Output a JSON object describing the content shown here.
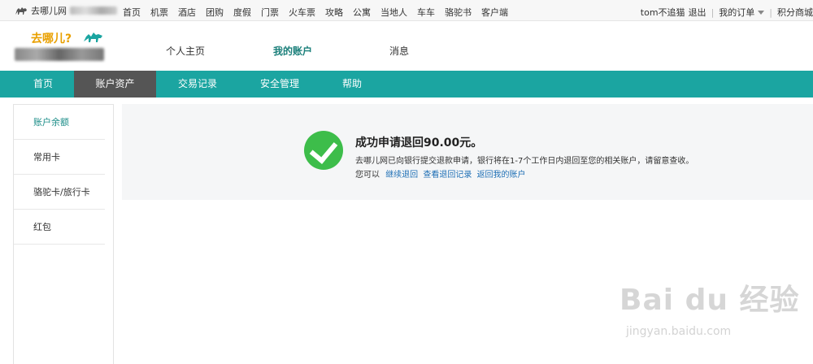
{
  "topbar": {
    "brand": "去哪儿网",
    "nav": [
      "首页",
      "机票",
      "酒店",
      "团购",
      "度假",
      "门票",
      "火车票",
      "攻略",
      "公寓",
      "当地人",
      "车车",
      "骆驼书",
      "客户端"
    ],
    "user": "tom不追猫",
    "logout": "退出",
    "my_orders": "我的订单",
    "points_mall": "积分商城"
  },
  "header": {
    "logo_text": "去哪儿?",
    "nav": [
      {
        "label": "个人主页",
        "active": false
      },
      {
        "label": "我的账户",
        "active": true
      },
      {
        "label": "消息",
        "active": false
      }
    ]
  },
  "mainnav": {
    "items": [
      {
        "label": "首页",
        "active": false
      },
      {
        "label": "账户资产",
        "active": true
      },
      {
        "label": "交易记录",
        "active": false
      },
      {
        "label": "安全管理",
        "active": false
      },
      {
        "label": "帮助",
        "active": false
      }
    ]
  },
  "sidebar": {
    "items": [
      {
        "label": "账户余额",
        "active": true
      },
      {
        "label": "常用卡",
        "active": false
      },
      {
        "label": "骆驼卡/旅行卡",
        "active": false
      },
      {
        "label": "红包",
        "active": false
      }
    ]
  },
  "message": {
    "title": "成功申请退回90.00元。",
    "desc": "去哪儿网已向银行提交退款申请，银行将在1-7个工作日内退回至您的相关账户，请留意查收。",
    "links_prefix": "您可以",
    "links": [
      "继续退回",
      "查看退回记录",
      "返回我的账户"
    ]
  },
  "watermark": {
    "main": "Bai du 经验",
    "sub": "jingyan.baidu.com"
  },
  "colors": {
    "teal": "#1ba5a1",
    "active_tab": "#555555",
    "success": "#3dbd4a",
    "link": "#1e6fb5"
  }
}
